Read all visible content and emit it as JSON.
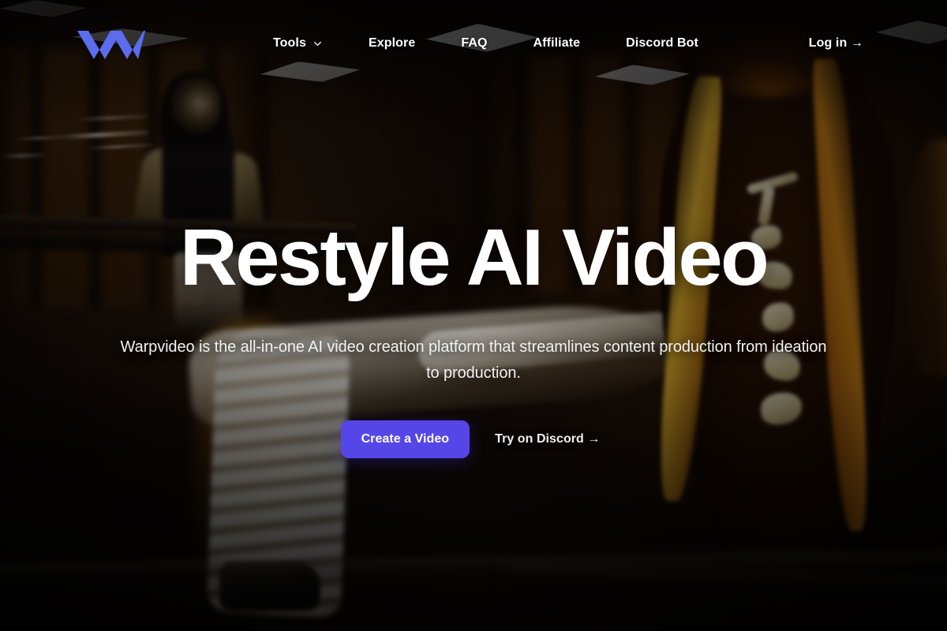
{
  "site": {
    "brand_name": "Warpvideo",
    "logo_icon": "warpvideo-w-logo",
    "accent_color": "#5546e8",
    "logo_color": "#5b6ced"
  },
  "header": {
    "nav_items": [
      {
        "label": "Tools",
        "icon": "chevron-down-icon",
        "has_dropdown": true
      },
      {
        "label": "Explore",
        "has_dropdown": false
      },
      {
        "label": "FAQ",
        "has_dropdown": false
      },
      {
        "label": "Affiliate",
        "has_dropdown": false
      },
      {
        "label": "Discord Bot",
        "has_dropdown": false
      }
    ],
    "login_label": "Log in →"
  },
  "hero": {
    "title": "Restyle AI Video",
    "subtitle": "Warpvideo is the all-in-one AI video creation platform that streamlines content production from ideation to production.",
    "primary_cta": "Create a Video",
    "secondary_cta": "Try on Discord →"
  }
}
